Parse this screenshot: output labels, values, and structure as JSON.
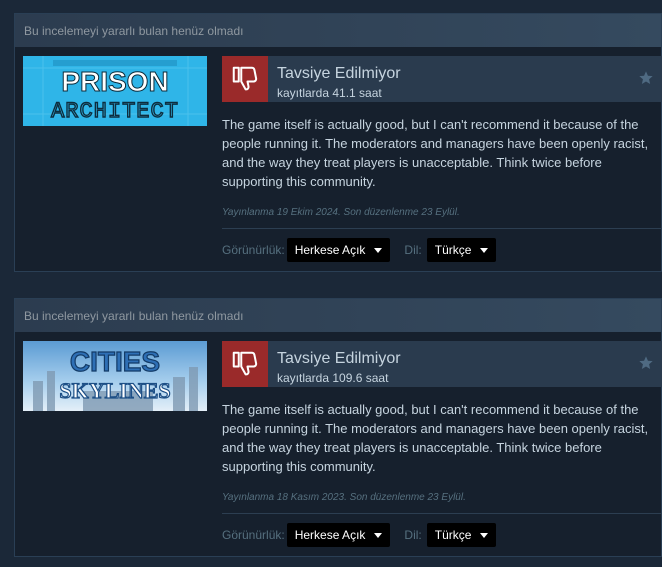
{
  "reviews": [
    {
      "helpful_header": "Bu incelemeyi yararlı bulan henüz olmadı",
      "game": "PRISON ARCHITECT",
      "game_line1": "PRISON",
      "game_line2": "ARCHITECT",
      "verdict": "Tavsiye Edilmiyor",
      "hours": "kayıtlarda 41.1 saat",
      "text": "The game itself is actually good, but I can't recommend it because of the people running it. The moderators and managers have been openly racist, and the way they treat players is unacceptable. Think twice before supporting this community.",
      "dates": "Yayınlanma 19 Ekim 2024. Son düzenlenme 23 Eylül.",
      "visibility_label": "Görünürlük:",
      "visibility_value": "Herkese Açık",
      "language_label": "Dil:",
      "language_value": "Türkçe"
    },
    {
      "helpful_header": "Bu incelemeyi yararlı bulan henüz olmadı",
      "game": "CITIES SKYLINES",
      "game_line1": "CITIES",
      "game_line2": "SKYLINES",
      "verdict": "Tavsiye Edilmiyor",
      "hours": "kayıtlarda 109.6 saat",
      "text": "The game itself is actually good, but I can't recommend it because of the people running it. The moderators and managers have been openly racist, and the way they treat players is unacceptable. Think twice before supporting this community.",
      "dates": "Yayınlanma 18 Kasım 2023. Son düzenlenme 23 Eylül.",
      "visibility_label": "Görünürlük:",
      "visibility_value": "Herkese Açık",
      "language_label": "Dil:",
      "language_value": "Türkçe"
    }
  ],
  "icons": {
    "thumb": "thumbs-down-icon",
    "star": "star-icon",
    "caret": "caret-down-icon"
  },
  "colors": {
    "page_bg": "#1b2838",
    "thumb_bg": "#9a2a2a",
    "text": "#c6d4df",
    "muted": "#56707f"
  }
}
